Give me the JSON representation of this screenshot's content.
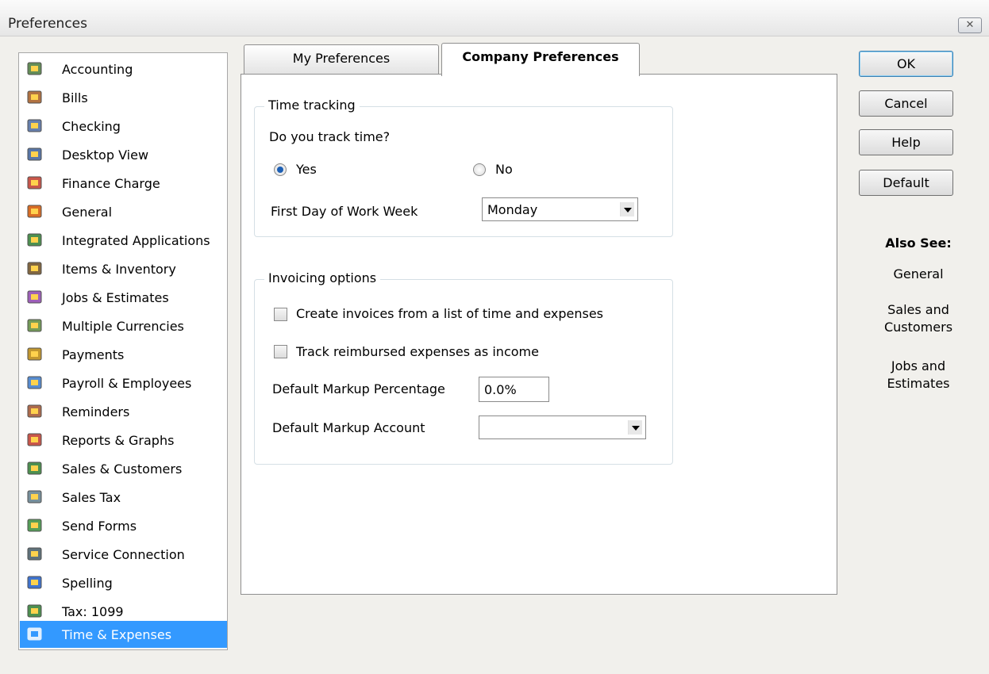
{
  "window": {
    "title": "Preferences",
    "close_glyph": "✕"
  },
  "sidebar": {
    "selected_index": 20,
    "items": [
      {
        "label": "Accounting",
        "icon": "accounting-icon",
        "color": "#4a7a3a"
      },
      {
        "label": "Bills",
        "icon": "bills-icon",
        "color": "#a55a20"
      },
      {
        "label": "Checking",
        "icon": "checking-icon",
        "color": "#4c6aa0"
      },
      {
        "label": "Desktop View",
        "icon": "desktop-view-icon",
        "color": "#3b5f9a"
      },
      {
        "label": "Finance Charge",
        "icon": "finance-charge-icon",
        "color": "#c0392b"
      },
      {
        "label": "General",
        "icon": "general-icon",
        "color": "#d35400"
      },
      {
        "label": "Integrated Applications",
        "icon": "integrated-applications-icon",
        "color": "#2e7d32"
      },
      {
        "label": "Items & Inventory",
        "icon": "items-inventory-icon",
        "color": "#6d4c1f"
      },
      {
        "label": "Jobs & Estimates",
        "icon": "jobs-estimates-icon",
        "color": "#8e44ad"
      },
      {
        "label": "Multiple Currencies",
        "icon": "multiple-currencies-icon",
        "color": "#5c8a3c"
      },
      {
        "label": "Payments",
        "icon": "payments-icon",
        "color": "#b8860b"
      },
      {
        "label": "Payroll & Employees",
        "icon": "payroll-employees-icon",
        "color": "#3a79c9"
      },
      {
        "label": "Reminders",
        "icon": "reminders-icon",
        "color": "#a0522d"
      },
      {
        "label": "Reports & Graphs",
        "icon": "reports-graphs-icon",
        "color": "#c0392b"
      },
      {
        "label": "Sales & Customers",
        "icon": "sales-customers-icon",
        "color": "#2e7d32"
      },
      {
        "label": "Sales Tax",
        "icon": "sales-tax-icon",
        "color": "#607d8b"
      },
      {
        "label": "Send Forms",
        "icon": "send-forms-icon",
        "color": "#388e3c"
      },
      {
        "label": "Service Connection",
        "icon": "service-connection-icon",
        "color": "#455a64"
      },
      {
        "label": "Spelling",
        "icon": "spelling-icon",
        "color": "#1e5cc8"
      },
      {
        "label": "Tax: 1099",
        "icon": "tax-1099-icon",
        "color": "#2e7d32"
      },
      {
        "label": "Time & Expenses",
        "icon": "time-expenses-icon",
        "color": "#ffffff"
      }
    ]
  },
  "tabs": [
    {
      "label": "My Preferences",
      "active": false
    },
    {
      "label": "Company Preferences",
      "active": true
    }
  ],
  "time_tracking": {
    "legend": "Time tracking",
    "question": "Do you track time?",
    "yes_label": "Yes",
    "no_label": "No",
    "selected": "yes",
    "first_day_label": "First Day of Work Week",
    "first_day_value": "Monday"
  },
  "invoicing": {
    "legend": "Invoicing options",
    "create_invoices_label": "Create invoices from a list of time and expenses",
    "create_invoices_checked": false,
    "track_reimbursed_label": "Track reimbursed expenses as income",
    "track_reimbursed_checked": false,
    "markup_pct_label": "Default Markup Percentage",
    "markup_pct_value": "0.0%",
    "markup_account_label": "Default Markup Account",
    "markup_account_value": ""
  },
  "buttons": {
    "ok": "OK",
    "cancel": "Cancel",
    "help": "Help",
    "default": "Default"
  },
  "also_see": {
    "title": "Also See:",
    "links": [
      "General",
      "Sales and\nCustomers",
      "Jobs and\nEstimates"
    ]
  },
  "colors": {
    "selection": "#3399ff",
    "radio_dot": "#1d5fb4"
  }
}
